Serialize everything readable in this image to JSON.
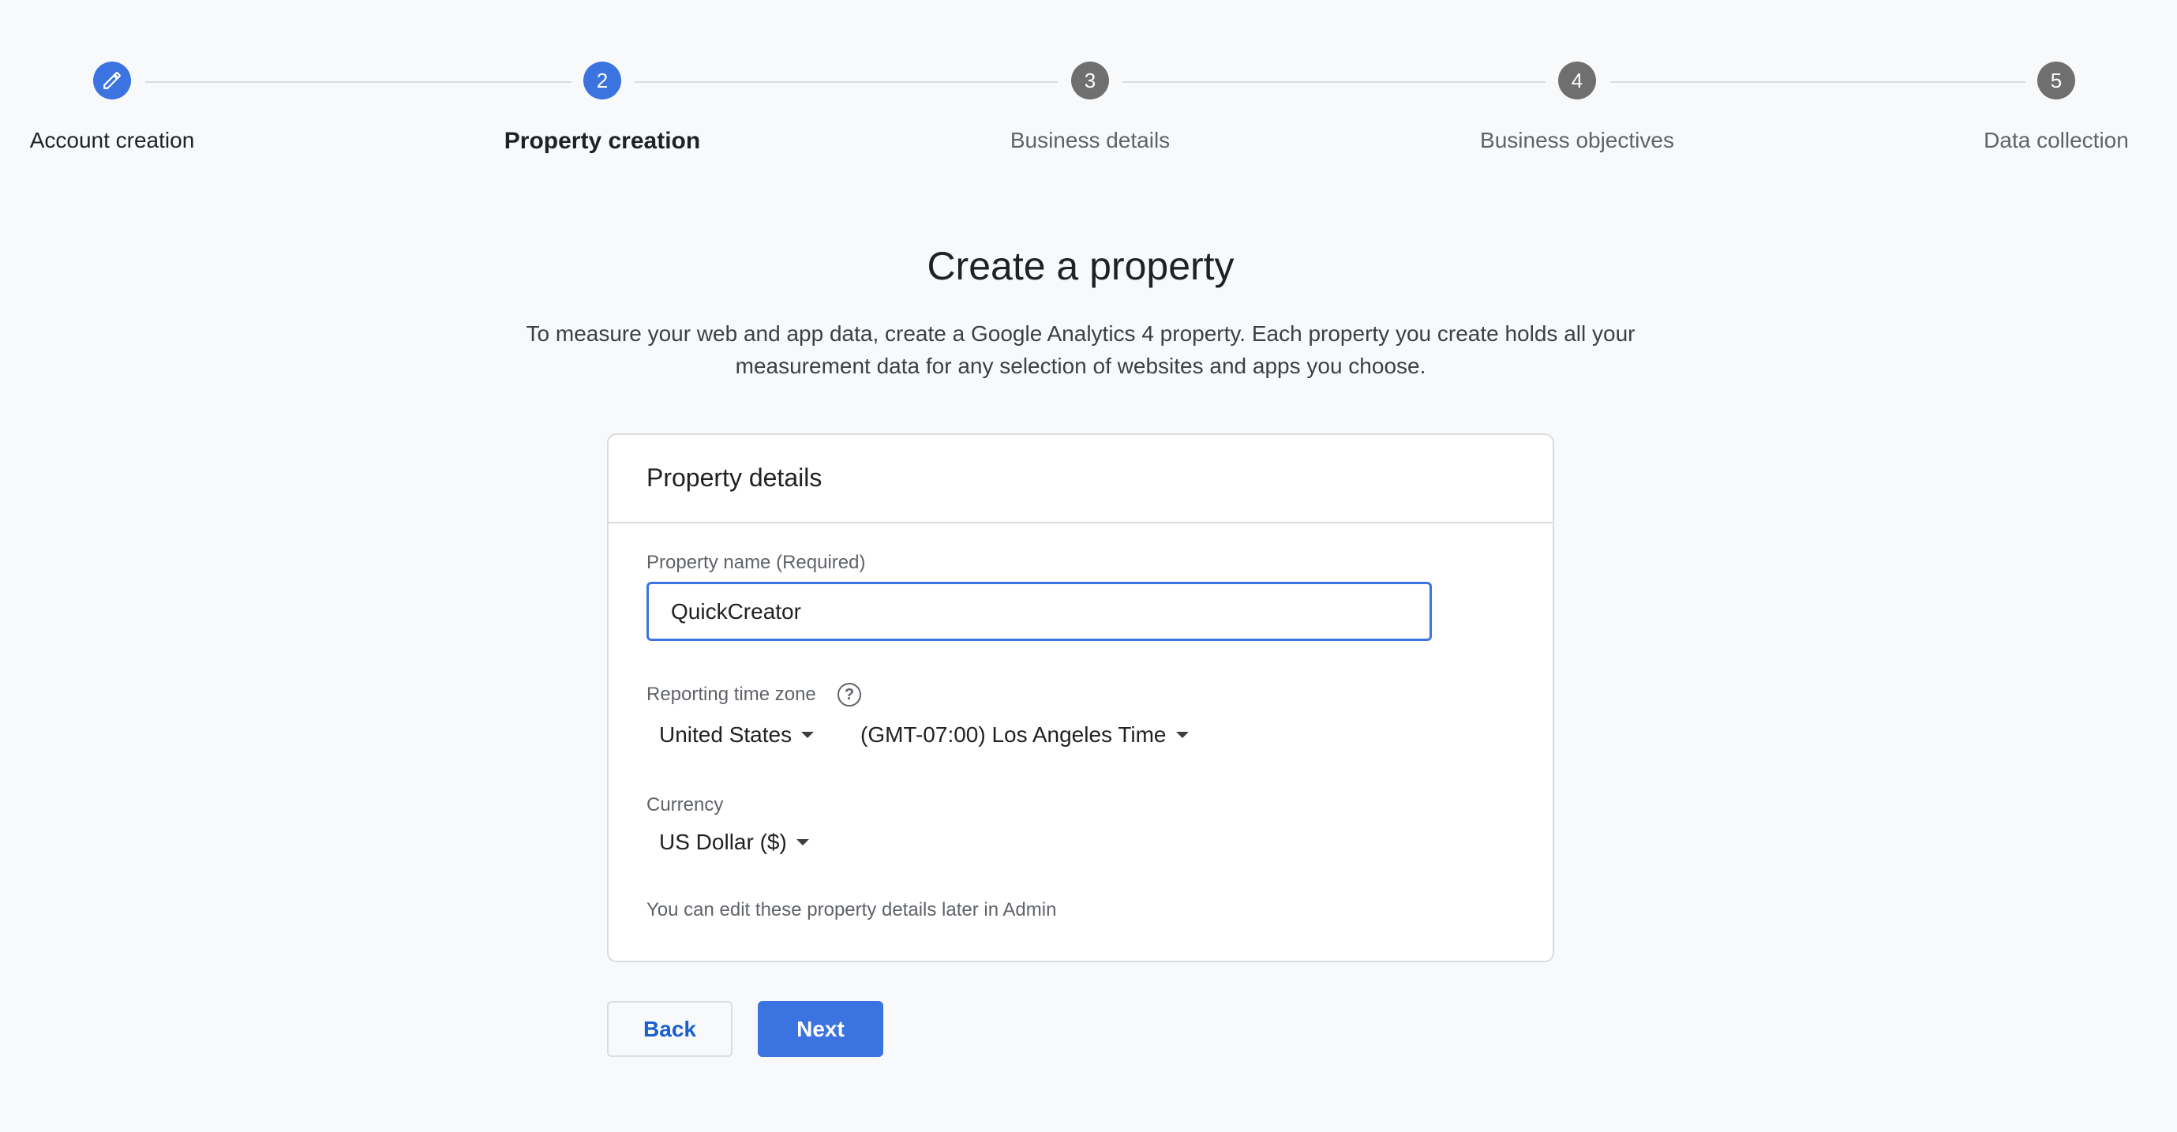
{
  "stepper": {
    "steps": [
      {
        "number": "",
        "label": "Account creation",
        "state": "done",
        "icon": "pencil-icon"
      },
      {
        "number": "2",
        "label": "Property creation",
        "state": "current"
      },
      {
        "number": "3",
        "label": "Business details",
        "state": "todo"
      },
      {
        "number": "4",
        "label": "Business objectives",
        "state": "todo"
      },
      {
        "number": "5",
        "label": "Data collection",
        "state": "todo"
      }
    ]
  },
  "page": {
    "title": "Create a property",
    "description_line1": "To measure your web and app data, create a Google Analytics 4 property. Each property you create holds all your",
    "description_line2": "measurement data for any selection of websites and apps you choose."
  },
  "card": {
    "title": "Property details",
    "property_name_label": "Property name (Required)",
    "property_name_value": "QuickCreator",
    "timezone_label": "Reporting time zone",
    "help_icon": "help-circle-icon",
    "country": "United States",
    "timezone": "(GMT-07:00) Los Angeles Time",
    "currency_label": "Currency",
    "currency": "US Dollar ($)",
    "note": "You can edit these property details later in Admin"
  },
  "buttons": {
    "back": "Back",
    "next": "Next"
  },
  "colors": {
    "accent": "#3b73e0",
    "inactive_step": "#6f6f6f",
    "background": "#f8f9fa"
  }
}
